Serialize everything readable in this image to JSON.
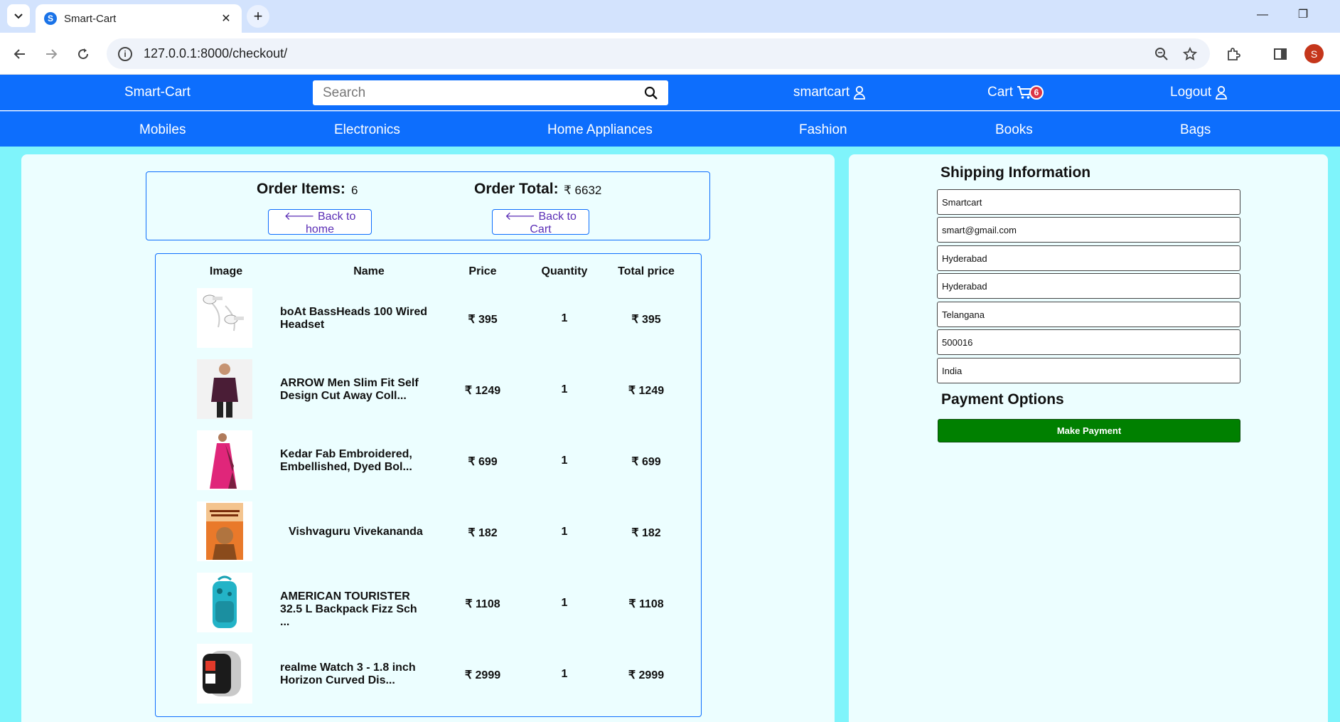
{
  "browser": {
    "tab_title": "Smart-Cart",
    "url": "127.0.0.1:8000/checkout/",
    "profile_initial": "S"
  },
  "header": {
    "brand": "Smart-Cart",
    "search_placeholder": "Search",
    "user_label": "smartcart",
    "cart_label": "Cart",
    "cart_count": "6",
    "logout_label": "Logout"
  },
  "categories": [
    "Mobiles",
    "Electronics",
    "Home Appliances",
    "Fashion",
    "Books",
    "Bags"
  ],
  "summary": {
    "items_label": "Order Items:",
    "items_value": "6",
    "total_label": "Order Total:",
    "total_value": "₹ 6632",
    "back_home": "🡐 Back to home",
    "back_cart": "🡐 Back to Cart"
  },
  "table": {
    "headers": [
      "Image",
      "Name",
      "Price",
      "Quantity",
      "Total price"
    ],
    "rows": [
      {
        "name": "boAt BassHeads 100 Wired Headset",
        "price": "₹ 395",
        "qty": "1",
        "total": "₹ 395",
        "image": "earphones-image"
      },
      {
        "name": "ARROW Men Slim Fit Self Design Cut Away Coll...",
        "price": "₹ 1249",
        "qty": "1",
        "total": "₹ 1249",
        "image": "shirt-image"
      },
      {
        "name": "Kedar Fab Embroidered, Embellished, Dyed Bol...",
        "price": "₹ 699",
        "qty": "1",
        "total": "₹ 699",
        "image": "saree-image"
      },
      {
        "name": "Vishvaguru Vivekananda",
        "price": "₹ 182",
        "qty": "1",
        "total": "₹ 182",
        "image": "book-image"
      },
      {
        "name": "AMERICAN TOURISTER 32.5 L Backpack Fizz Sch ...",
        "price": "₹ 1108",
        "qty": "1",
        "total": "₹ 1108",
        "image": "backpack-image"
      },
      {
        "name": "realme Watch 3 - 1.8 inch Horizon Curved Dis...",
        "price": "₹ 2999",
        "qty": "1",
        "total": "₹ 2999",
        "image": "watch-image"
      }
    ]
  },
  "shipping": {
    "title": "Shipping Information",
    "fields": [
      "Smartcart",
      "smart@gmail.com",
      "Hyderabad",
      "Hyderabad",
      "Telangana",
      "500016",
      "India"
    ]
  },
  "payment": {
    "title": "Payment Options",
    "button": "Make Payment"
  },
  "colors": {
    "header_blue": "#0d6efd",
    "page_cyan": "#7ff4fb",
    "panel_bg": "#ecfeff",
    "pay_green": "#008000",
    "badge_red": "#dc3545"
  }
}
